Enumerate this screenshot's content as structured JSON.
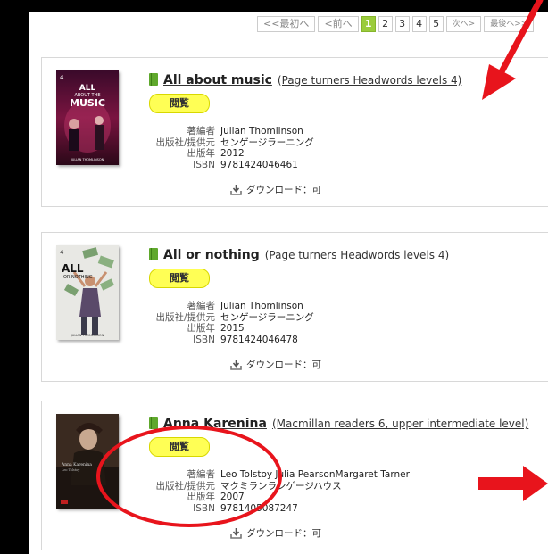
{
  "pagination": {
    "first": "<<最初へ",
    "prev": "<前へ",
    "pages": [
      "1",
      "2",
      "3",
      "4",
      "5"
    ],
    "current": "1",
    "next": "次へ>",
    "last": "最後へ>>"
  },
  "labels": {
    "browse": "閲覧",
    "author": "著編者",
    "publisher": "出版社/提供元",
    "year": "出版年",
    "isbn": "ISBN",
    "download": "ダウンロード：可"
  },
  "books": [
    {
      "title": "All about music",
      "series": "(Page turners Headwords levels 4)",
      "author": "Julian Thomlinson",
      "publisher": "センゲージラーニング",
      "year": "2012",
      "isbn": "9781424046461",
      "cover_text": "ALL ABOUT THE MUSIC",
      "cover_level": "4",
      "cover_author": "JULIAN THOMLINSON"
    },
    {
      "title": "All or nothing",
      "series": "(Page turners Headwords levels 4)",
      "author": "Julian Thomlinson",
      "publisher": "センゲージラーニング",
      "year": "2015",
      "isbn": "9781424046478",
      "cover_text": "ALL OR NOTHING",
      "cover_level": "4",
      "cover_author": "JULIAN THOMLINSON"
    },
    {
      "title": "Anna Karenina",
      "series": "(Macmillan readers 6, upper intermediate level)",
      "author": "Leo Tolstoy Julia PearsonMargaret Tarner",
      "publisher": "マクミランランゲージハウス",
      "year": "2007",
      "isbn": "9781405087247",
      "cover_text": "Anna Karenina",
      "cover_level": "",
      "cover_author": "Leo Tolstoy"
    }
  ],
  "colors": {
    "annotation_red": "#e8141c",
    "accent_green": "#9bcc3c",
    "browse_yellow": "#ffff55"
  }
}
